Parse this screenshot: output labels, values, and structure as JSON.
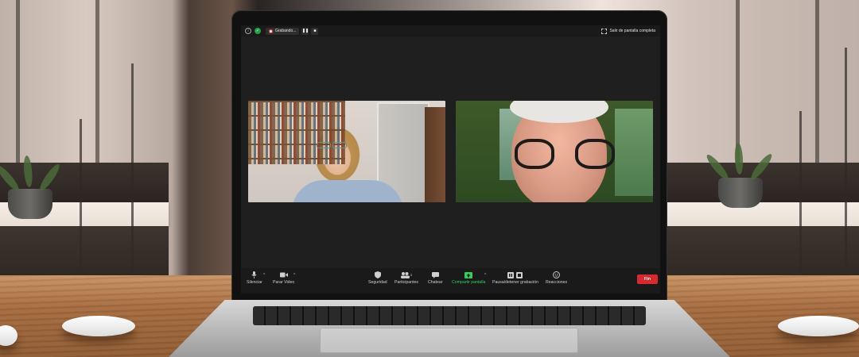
{
  "meeting": {
    "recording_label": "Grabando...",
    "exit_fullscreen_label": "Salir de pantalla completa"
  },
  "toolbar": {
    "mute_label": "Silenciar",
    "stop_video_label": "Parar Video",
    "security_label": "Seguridad",
    "participants_label": "Participantes",
    "participants_count": "1",
    "chat_label": "Chatear",
    "share_screen_label": "Compartir pantalla",
    "pause_recording_label": "Pausa/detener grabación",
    "reactions_label": "Reacciones",
    "end_label": "Fin"
  },
  "colors": {
    "share_green": "#2fd15a",
    "end_red": "#d9292f",
    "security_badge_green": "#1fa14b"
  },
  "icons": {
    "info": "info-icon",
    "security_badge": "shield-check-icon",
    "record": "record-icon",
    "pause": "pause-icon",
    "stop": "stop-icon",
    "fullscreen": "fullscreen-exit-icon",
    "mic": "microphone-icon",
    "camera": "video-camera-icon",
    "security": "shield-icon",
    "participants": "people-icon",
    "chat": "chat-bubble-icon",
    "share": "share-screen-icon",
    "reactions": "emoji-icon"
  }
}
